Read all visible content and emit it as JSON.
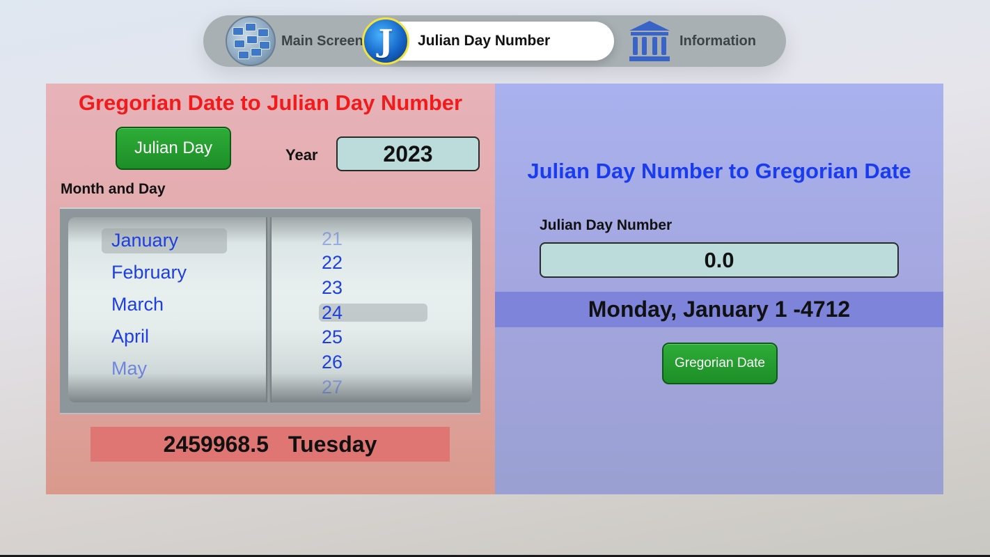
{
  "tabs": {
    "main": "Main Screen",
    "julian": "Julian Day Number",
    "info": "Information",
    "julian_icon_letter": "J"
  },
  "left": {
    "title": "Gregorian Date to Julian Day Number",
    "button": "Julian Day",
    "year_label": "Year",
    "year_value": "2023",
    "month_day_label": "Month and Day",
    "months": [
      "January",
      "February",
      "March",
      "April",
      "May"
    ],
    "selected_month": "January",
    "days": [
      "21",
      "22",
      "23",
      "24",
      "25",
      "26",
      "27"
    ],
    "selected_day": "24",
    "result_jd": "2459968.5",
    "result_weekday": "Tuesday"
  },
  "right": {
    "title": "Julian Day Number to Gregorian Date",
    "jdn_label": "Julian Day Number",
    "jdn_value": "0.0",
    "result_date": "Monday, January 1 -4712",
    "button": "Gregorian Date"
  },
  "colors": {
    "left_title": "#f21b1b",
    "right_title": "#1a3cf0",
    "button_green": "#2ead38",
    "picker_text": "#1e3fe0"
  }
}
